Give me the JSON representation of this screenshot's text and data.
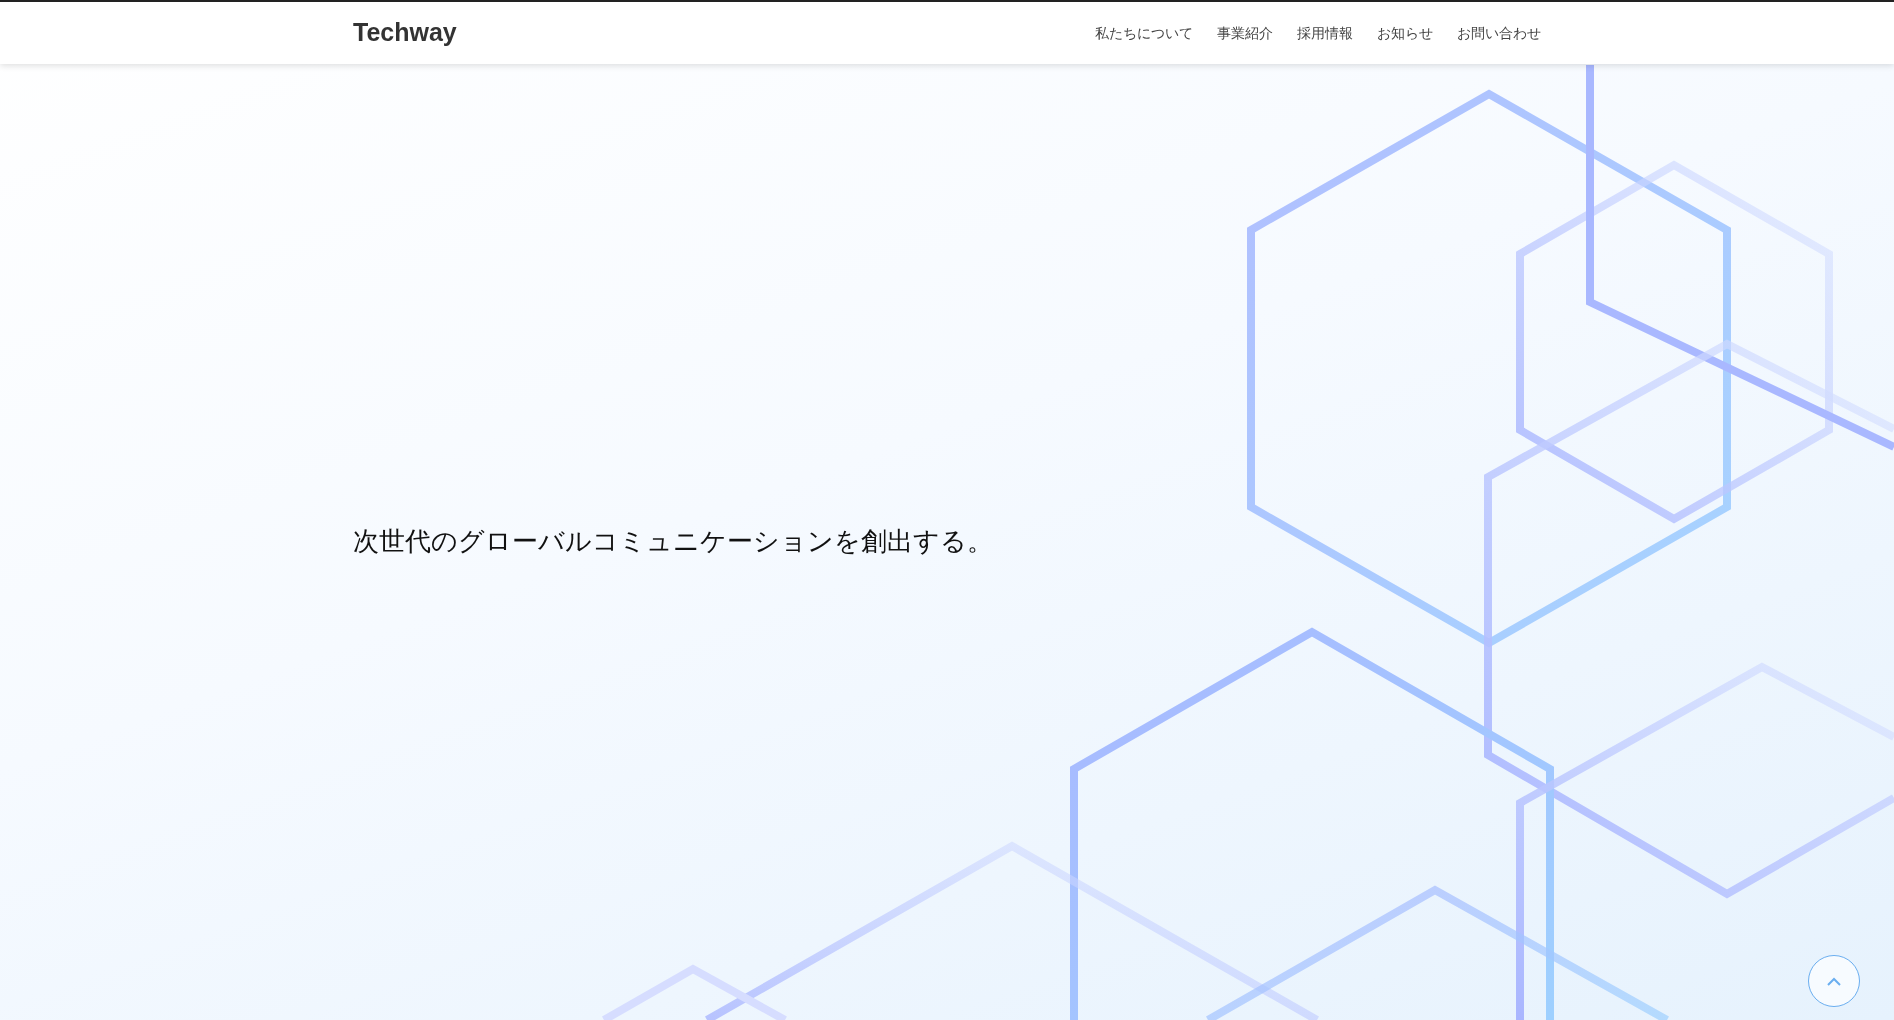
{
  "header": {
    "logo": "Techway",
    "nav": [
      {
        "label": "私たちについて"
      },
      {
        "label": "事業紹介"
      },
      {
        "label": "採用情報"
      },
      {
        "label": "お知らせ"
      },
      {
        "label": "お問い合わせ"
      }
    ]
  },
  "hero": {
    "tagline": "次世代のグローバルコミュニケーションを創出する。"
  }
}
